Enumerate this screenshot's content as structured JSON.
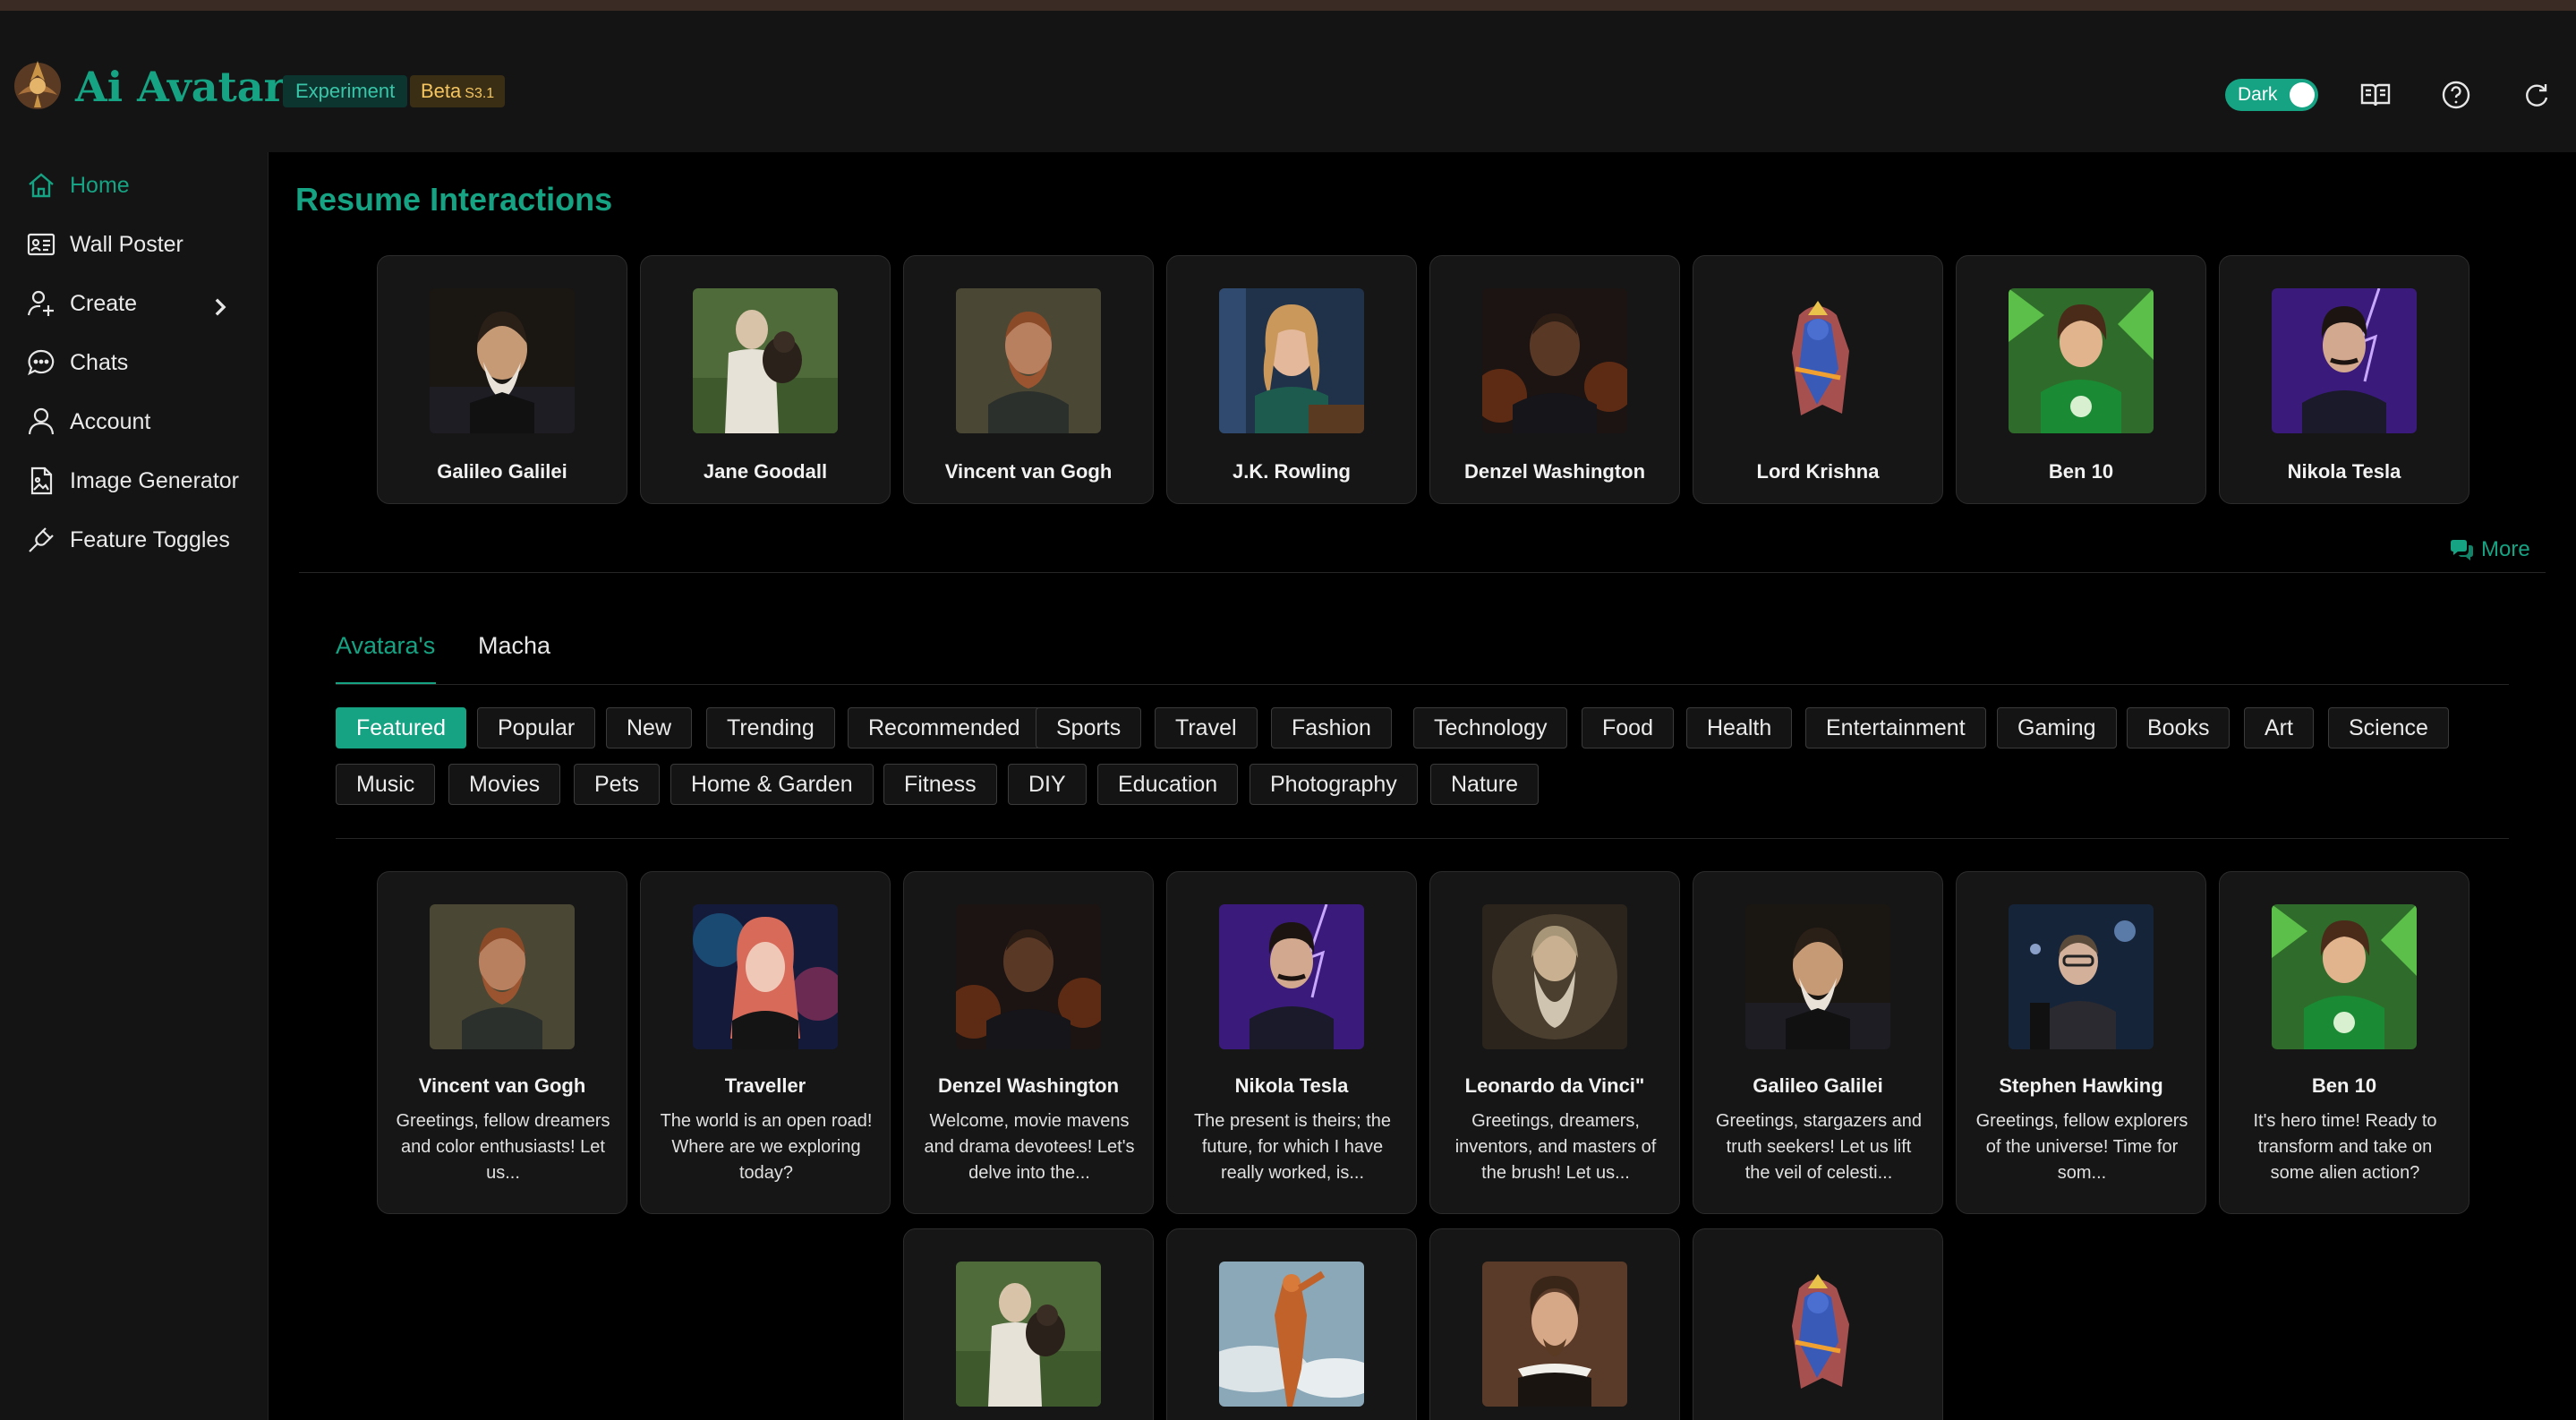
{
  "brand": {
    "name": "Ai Avatara",
    "experiment_tag": "Experiment",
    "beta_tag": "Beta",
    "beta_version": "S3.1"
  },
  "header": {
    "theme_toggle_label": "Dark",
    "theme_toggle_on": true,
    "icons": [
      "book-icon",
      "help-icon",
      "refresh-icon"
    ]
  },
  "sidebar": {
    "items": [
      {
        "label": "Home",
        "icon": "home-icon",
        "active": true
      },
      {
        "label": "Wall Poster",
        "icon": "id-card-icon"
      },
      {
        "label": "Create",
        "icon": "user-plus-icon",
        "has_submenu": true
      },
      {
        "label": "Chats",
        "icon": "chat-bubble-icon"
      },
      {
        "label": "Account",
        "icon": "user-icon"
      },
      {
        "label": "Image Generator",
        "icon": "file-image-icon"
      },
      {
        "label": "Feature Toggles",
        "icon": "plug-icon"
      }
    ]
  },
  "resume": {
    "title": "Resume Interactions",
    "cards": [
      {
        "name": "Galileo Galilei"
      },
      {
        "name": "Jane Goodall"
      },
      {
        "name": "Vincent van Gogh"
      },
      {
        "name": "J.K. Rowling"
      },
      {
        "name": "Denzel Washington"
      },
      {
        "name": "Lord Krishna"
      },
      {
        "name": "Ben 10"
      },
      {
        "name": "Nikola Tesla"
      }
    ],
    "more_label": "More"
  },
  "tabs": [
    {
      "label": "Avatara's",
      "active": true
    },
    {
      "label": "Macha",
      "active": false
    }
  ],
  "categories": {
    "row1": [
      "Featured",
      "Popular",
      "New",
      "Trending",
      "Recommended",
      "Sports",
      "Travel",
      "Fashion",
      "Technology",
      "Food",
      "Health",
      "Entertainment",
      "Gaming",
      "Books",
      "Art",
      "Science"
    ],
    "row2": [
      "Music",
      "Movies",
      "Pets",
      "Home & Garden",
      "Fitness",
      "DIY",
      "Education",
      "Photography",
      "Nature"
    ],
    "active": "Featured"
  },
  "featured": {
    "cards": [
      {
        "name": "Vincent van Gogh",
        "desc": "Greetings, fellow dreamers and color enthusiasts! Let us..."
      },
      {
        "name": "Traveller",
        "desc": "The world is an open road! Where are we exploring today?"
      },
      {
        "name": "Denzel Washington",
        "desc": "Welcome, movie mavens and drama devotees! Let's delve into the..."
      },
      {
        "name": "Nikola Tesla",
        "desc": "The present is theirs; the future, for which I have really worked, is..."
      },
      {
        "name": "Leonardo da Vinci\"",
        "desc": "Greetings, dreamers, inventors, and masters of the brush! Let us..."
      },
      {
        "name": "Galileo Galilei",
        "desc": "Greetings, stargazers and truth seekers! Let us lift the veil of celesti..."
      },
      {
        "name": "Stephen Hawking",
        "desc": "Greetings, fellow explorers of the universe! Time for som..."
      },
      {
        "name": "Ben 10",
        "desc": "It's hero time! Ready to transform and take on some alien action?"
      }
    ],
    "partial_cards": [
      {
        "portrait": "jane-goodall-portrait"
      },
      {
        "portrait": "iron-figure-portrait"
      },
      {
        "portrait": "shakespeare-portrait"
      },
      {
        "portrait": "krishna-portrait"
      }
    ]
  },
  "colors": {
    "accent": "#16a383",
    "sidebar_bg": "#141414",
    "card_bg": "#161616",
    "beta": "#f4c560"
  }
}
